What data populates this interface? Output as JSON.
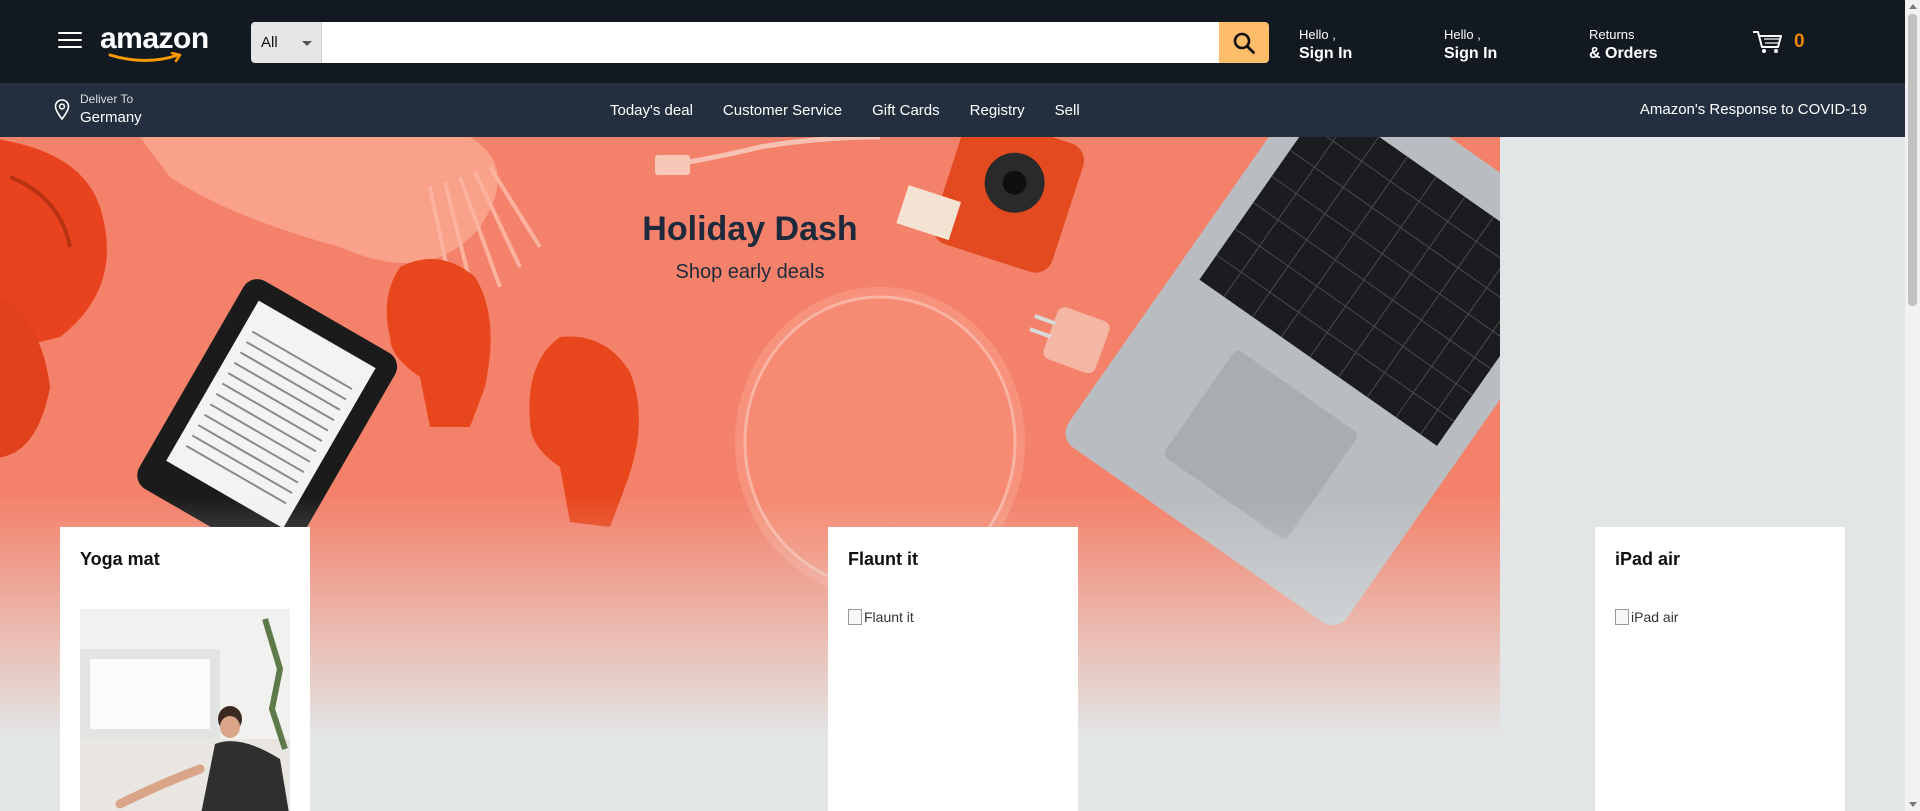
{
  "header": {
    "logo_text": "amazon",
    "search": {
      "category": "All",
      "placeholder": "",
      "value": ""
    },
    "account_1": {
      "greeting": "Hello ,",
      "action": "Sign In"
    },
    "account_2": {
      "greeting": "Hello ,",
      "action": "Sign In"
    },
    "returns": {
      "line1": "Returns",
      "line2": "& Orders"
    },
    "cart": {
      "count": "0"
    }
  },
  "subnav": {
    "deliver": {
      "label": "Deliver To",
      "location": "Germany"
    },
    "links": [
      "Today's deal",
      "Customer Service",
      "Gift Cards",
      "Registry",
      "Sell"
    ],
    "covid": "Amazon's Response to COVID-19"
  },
  "hero": {
    "title": "Holiday Dash",
    "subtitle": "Shop early deals"
  },
  "cards": [
    {
      "title": "Yoga mat",
      "image_alt": "Yoga mat"
    },
    {
      "title": "Flaunt it",
      "image_alt": "Flaunt it"
    },
    {
      "title": "iPad air",
      "image_alt": "iPad air"
    }
  ],
  "colors": {
    "header_bg": "#131921",
    "subnav_bg": "#232f3e",
    "search_button": "#febd69",
    "cart_count": "#f08804",
    "hero_bg": "#f4826b",
    "page_bg": "#e3e6e6"
  }
}
